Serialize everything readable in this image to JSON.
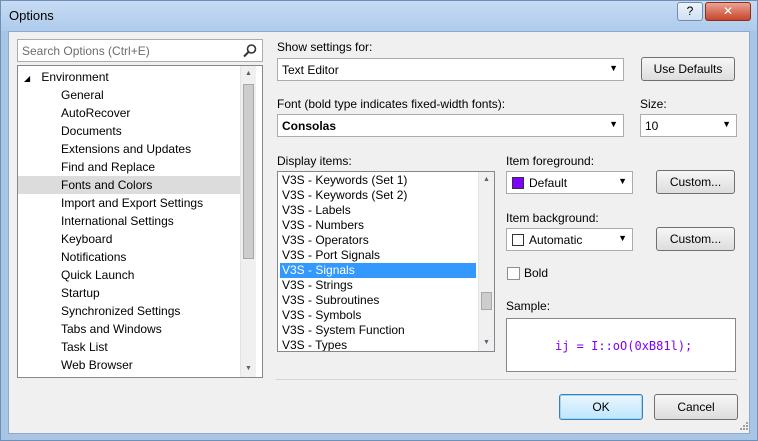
{
  "window": {
    "title": "Options",
    "help_label": "?",
    "close_label": "✕"
  },
  "search": {
    "placeholder": "Search Options (Ctrl+E)"
  },
  "tree": {
    "root": {
      "label": "Environment",
      "expander": "◢"
    },
    "items": [
      "General",
      "AutoRecover",
      "Documents",
      "Extensions and Updates",
      "Find and Replace",
      "Fonts and Colors",
      "Import and Export Settings",
      "International Settings",
      "Keyboard",
      "Notifications",
      "Quick Launch",
      "Startup",
      "Synchronized Settings",
      "Tabs and Windows",
      "Task List",
      "Web Browser"
    ],
    "selected": "Fonts and Colors"
  },
  "settings": {
    "show_settings_label": "Show settings for:",
    "show_settings_value": "Text Editor",
    "use_defaults_label": "Use Defaults",
    "font_label": "Font (bold type indicates fixed-width fonts):",
    "font_value": "Consolas",
    "size_label": "Size:",
    "size_value": "10"
  },
  "display_items": {
    "label": "Display items:",
    "items": [
      "V3S - Keywords (Set 1)",
      "V3S - Keywords (Set 2)",
      "V3S - Labels",
      "V3S - Numbers",
      "V3S - Operators",
      "V3S - Port Signals",
      "V3S - Signals",
      "V3S - Strings",
      "V3S - Subroutines",
      "V3S - Symbols",
      "V3S - System Function",
      "V3S - Types"
    ],
    "selected": "V3S - Signals"
  },
  "foreground": {
    "label": "Item foreground:",
    "value": "Default",
    "swatch_color": "#8000ff",
    "custom_label": "Custom..."
  },
  "background": {
    "label": "Item background:",
    "value": "Automatic",
    "swatch_color": "#ffffff",
    "custom_label": "Custom..."
  },
  "bold": {
    "label": "Bold",
    "checked": false
  },
  "sample": {
    "label": "Sample:",
    "text": "ij = I::oO(0xB81l);",
    "color": "#8000ff"
  },
  "footer": {
    "ok_label": "OK",
    "cancel_label": "Cancel"
  },
  "icons": {
    "search": "magnifier-icon",
    "dropdown": "▼",
    "up": "▲",
    "down": "▼"
  }
}
